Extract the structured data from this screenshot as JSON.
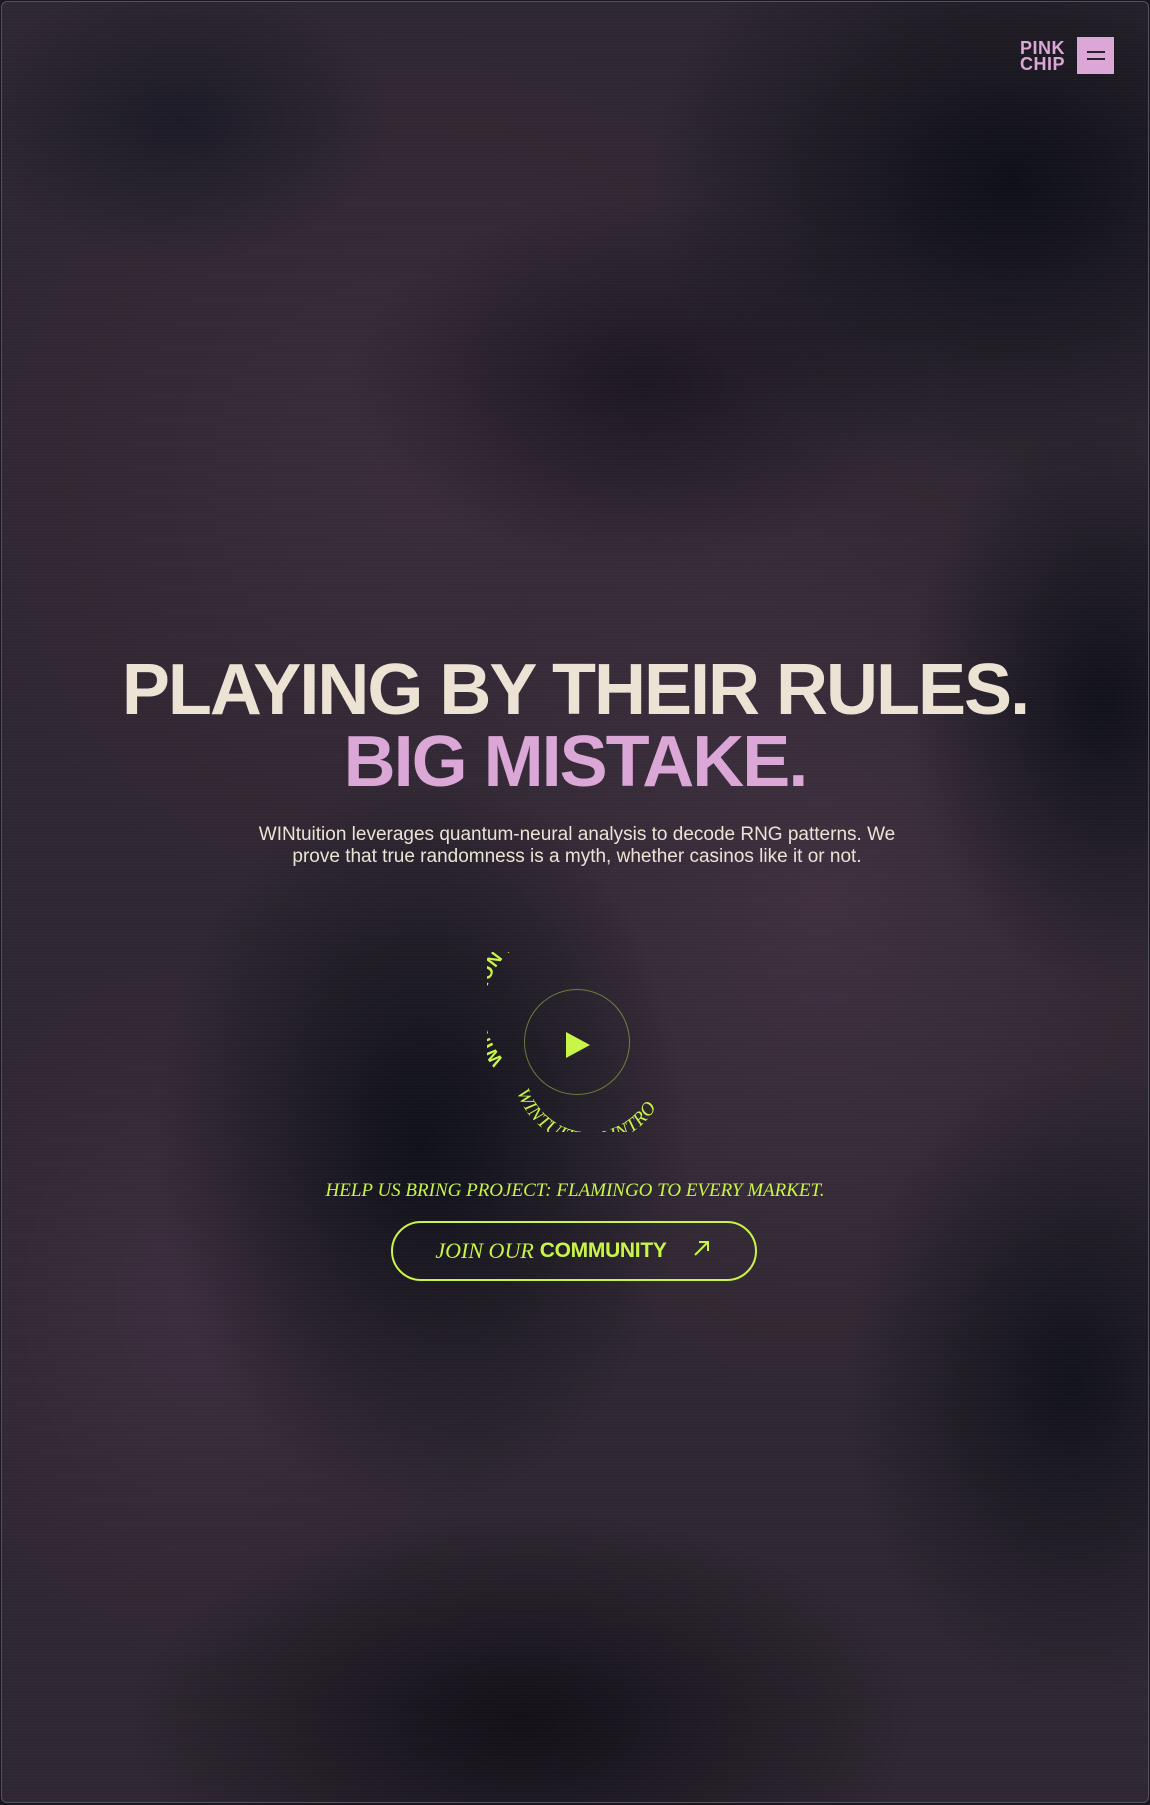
{
  "header": {
    "logo_line1": "PINK",
    "logo_line2": "CHIP",
    "menu_icon": "hamburger-menu-icon"
  },
  "hero": {
    "headline_line1": "PLAYING BY THEIR RULES.",
    "headline_line2": "BIG MISTAKE.",
    "subcopy": "WINtuition leverages quantum-neural analysis to decode RNG patterns. We prove that true randomness is a myth, whether casinos like it or not."
  },
  "intro_video": {
    "ring_text_top": "WINTUITION INTRO",
    "ring_text_bottom": "WINTUITION INTRO",
    "play_icon": "play-icon"
  },
  "community": {
    "tagline": "HELP US BRING PROJECT: FLAMINGO TO EVERY MARKET.",
    "cta_light": "JOIN OUR",
    "cta_bold": "COMMUNITY",
    "cta_icon": "arrow-up-right-icon"
  },
  "colors": {
    "accent_pink": "#dba7d6",
    "accent_lime": "#c8f547",
    "cream": "#ece3d5"
  }
}
